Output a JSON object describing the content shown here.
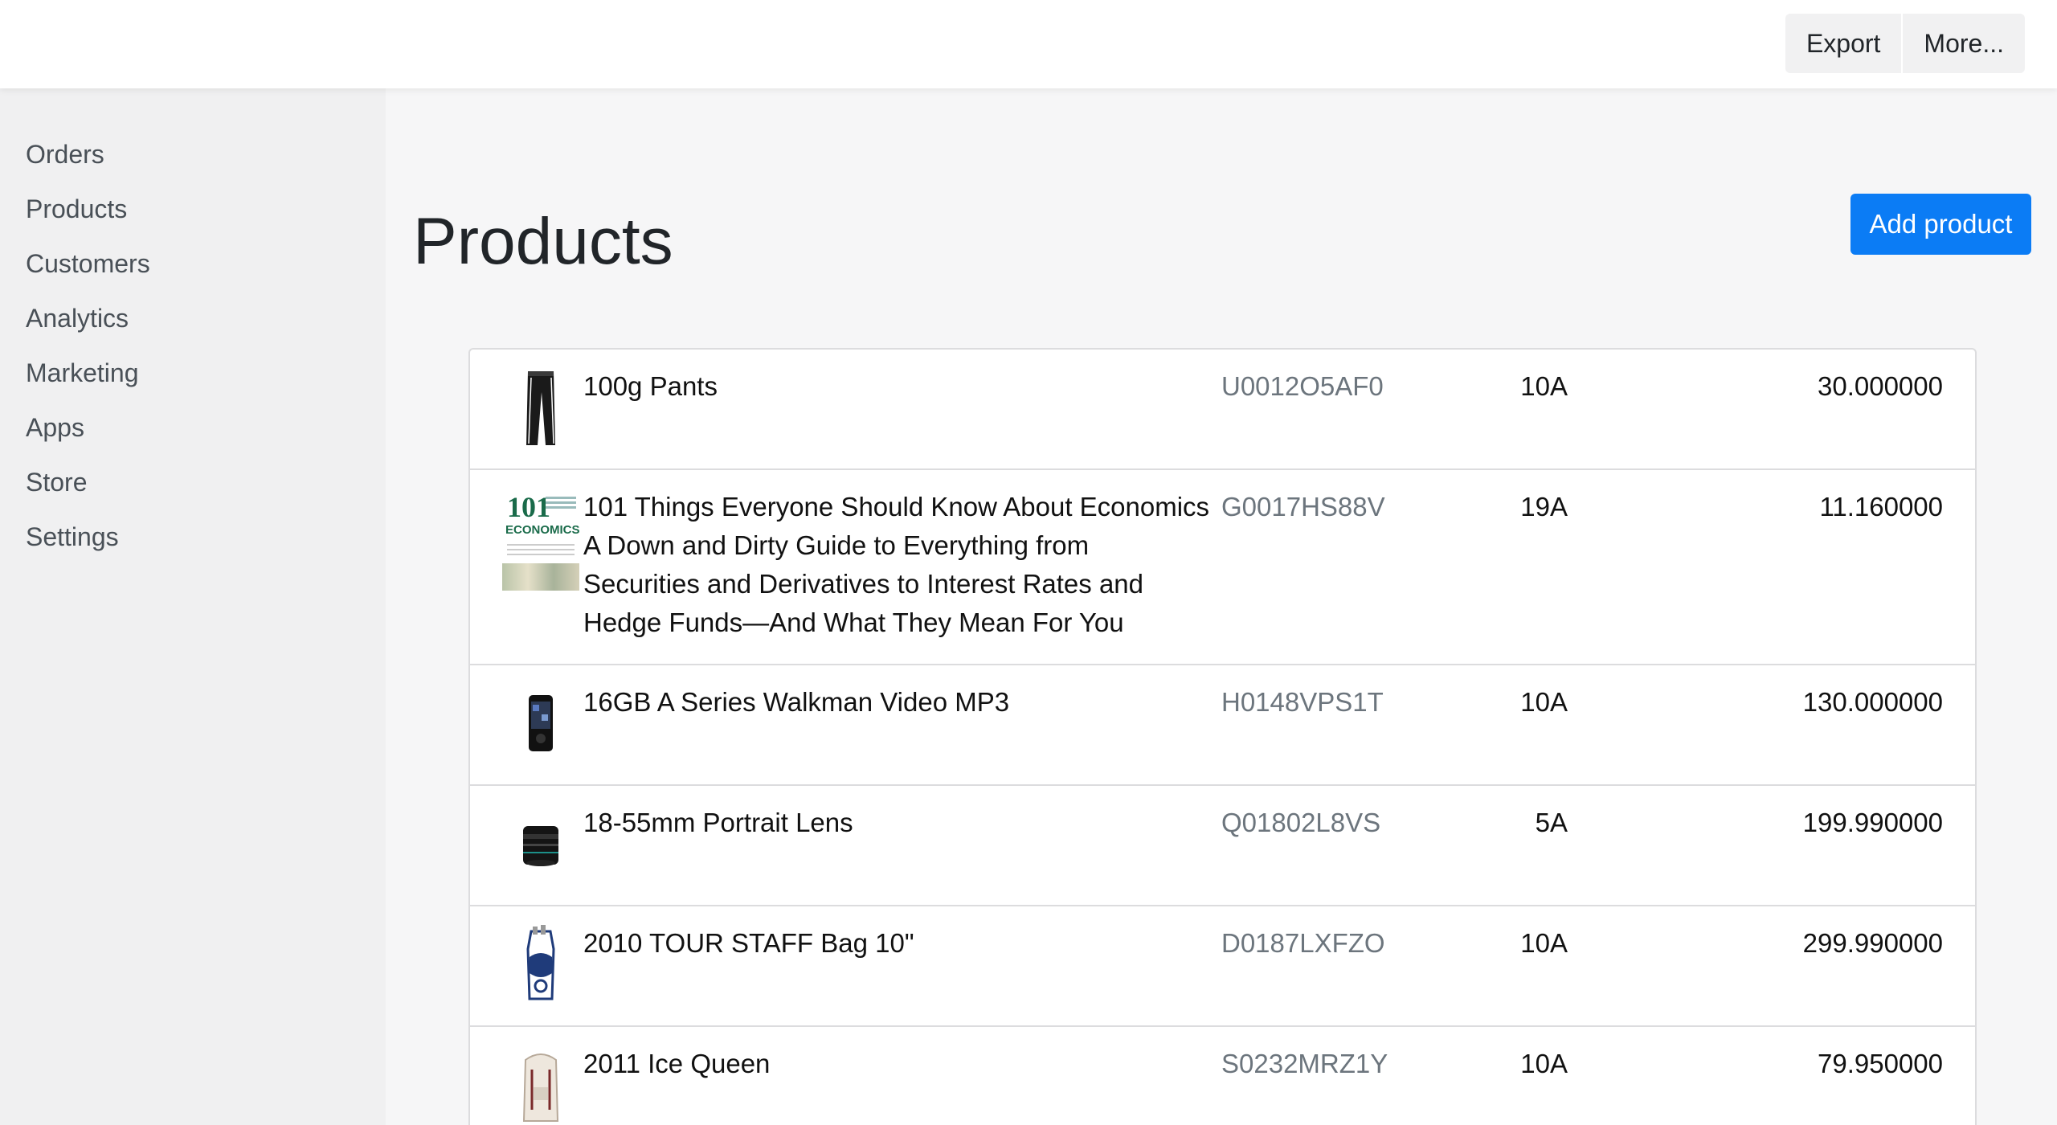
{
  "header": {
    "export_label": "Export",
    "more_label": "More..."
  },
  "sidebar": {
    "items": [
      {
        "label": "Orders"
      },
      {
        "label": "Products"
      },
      {
        "label": "Customers"
      },
      {
        "label": "Analytics"
      },
      {
        "label": "Marketing"
      },
      {
        "label": "Apps"
      },
      {
        "label": "Store"
      },
      {
        "label": "Settings"
      }
    ]
  },
  "main": {
    "title": "Products",
    "add_button_label": "Add product"
  },
  "products": [
    {
      "name": "100g Pants",
      "sku": "U0012O5AF0",
      "stock": "10A",
      "price": "30.000000",
      "icon": "pants-icon"
    },
    {
      "name": "101 Things Everyone Should Know About Economics A Down and Dirty Guide to Everything from Securities and Derivatives to Interest Rates and Hedge Funds—And What They Mean For You",
      "sku": "G0017HS88V",
      "stock": "19A",
      "price": "11.160000",
      "icon": "book-cover-icon",
      "cover_number": "101",
      "cover_word": "ECONOMICS"
    },
    {
      "name": "16GB A Series Walkman Video MP3",
      "sku": "H0148VPS1T",
      "stock": "10A",
      "price": "130.000000",
      "icon": "mp3-player-icon"
    },
    {
      "name": "18-55mm Portrait Lens",
      "sku": "Q01802L8VS",
      "stock": "5A",
      "price": "199.990000",
      "icon": "camera-lens-icon"
    },
    {
      "name": "2010 TOUR STAFF Bag 10\"",
      "sku": "D0187LXFZO",
      "stock": "10A",
      "price": "299.990000",
      "icon": "golf-bag-icon"
    },
    {
      "name": "2011 Ice Queen",
      "sku": "S0232MRZ1Y",
      "stock": "10A",
      "price": "79.950000",
      "icon": "backpack-icon"
    }
  ]
}
